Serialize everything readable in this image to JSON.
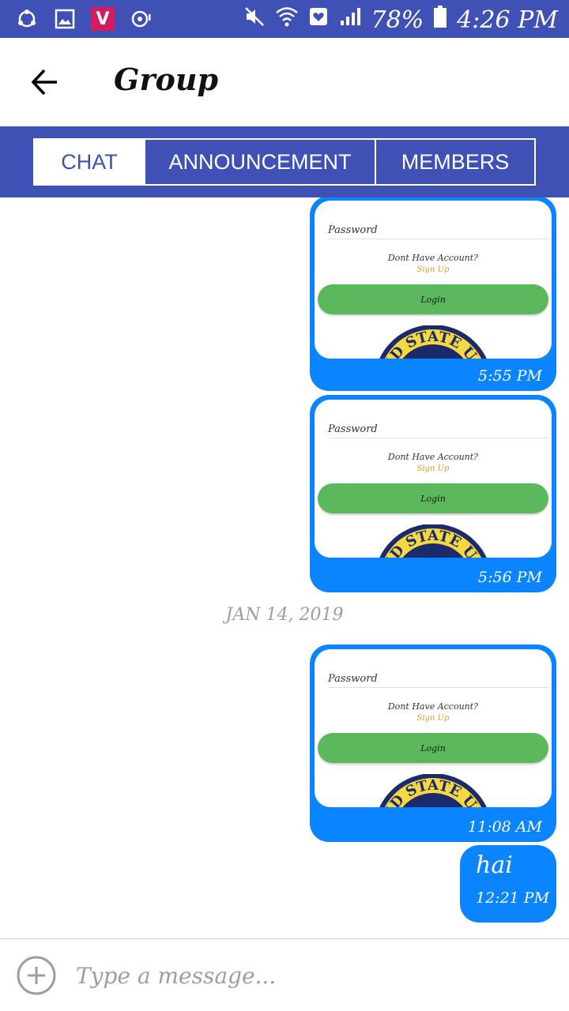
{
  "status_bar": {
    "battery": "78%",
    "time": "4:26 PM",
    "vidmate_label": "V",
    "icons": [
      "share-icon",
      "gallery-icon",
      "vidmate-icon",
      "sync-icon",
      "mute-icon",
      "wifi-icon",
      "heart-signal-icon",
      "signal-icon",
      "battery-icon"
    ]
  },
  "app_bar": {
    "title": "Group"
  },
  "tabs": [
    {
      "label": "CHAT",
      "active": true
    },
    {
      "label": "ANNOUNCEMENT",
      "active": false
    },
    {
      "label": "MEMBERS",
      "active": false
    }
  ],
  "screenshot_content": {
    "password_label": "Password",
    "no_account": "Dont Have Account?",
    "sign_up": "Sign Up",
    "login": "Login",
    "seal_text": "AND STATE U"
  },
  "messages": [
    {
      "type": "image",
      "time": "5:55 PM"
    },
    {
      "type": "image",
      "time": "5:56 PM"
    },
    {
      "type": "date",
      "text": "JAN 14, 2019"
    },
    {
      "type": "image",
      "time": "11:08 AM"
    },
    {
      "type": "text",
      "text": "hai",
      "time": "12:21 PM"
    }
  ],
  "composer": {
    "placeholder": "Type a message..."
  },
  "colors": {
    "primary": "#3f51b5",
    "bubble": "#0a84ff",
    "login_green": "#5cb85c"
  }
}
